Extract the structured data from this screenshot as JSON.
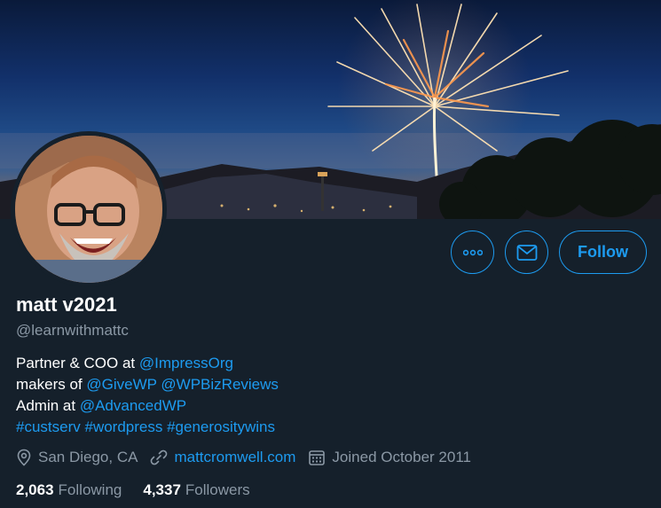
{
  "profile": {
    "display_name": "matt v2021",
    "handle": "@learnwithmattc",
    "bio": {
      "line1_prefix": "Partner & COO at",
      "line1_link": "@ImpressOrg",
      "line2_prefix": "makers of",
      "line2_link1": "@GiveWP",
      "line2_link2": "@WPBizReviews",
      "line3_prefix": "Admin at",
      "line3_link": "@AdvancedWP",
      "hashtag1": "#custserv",
      "hashtag2": "#wordpress",
      "hashtag3": "#generositywins"
    },
    "location": "San Diego, CA",
    "website": "mattcromwell.com",
    "joined": "Joined October 2011",
    "following_count": "2,063",
    "following_label": "Following",
    "followers_count": "4,337",
    "followers_label": "Followers"
  },
  "actions": {
    "follow_label": "Follow",
    "more_icon": "more-icon",
    "message_icon": "envelope-icon"
  },
  "colors": {
    "background": "#15202b",
    "accent": "#1d9bf0",
    "secondary_text": "#8b98a5"
  }
}
